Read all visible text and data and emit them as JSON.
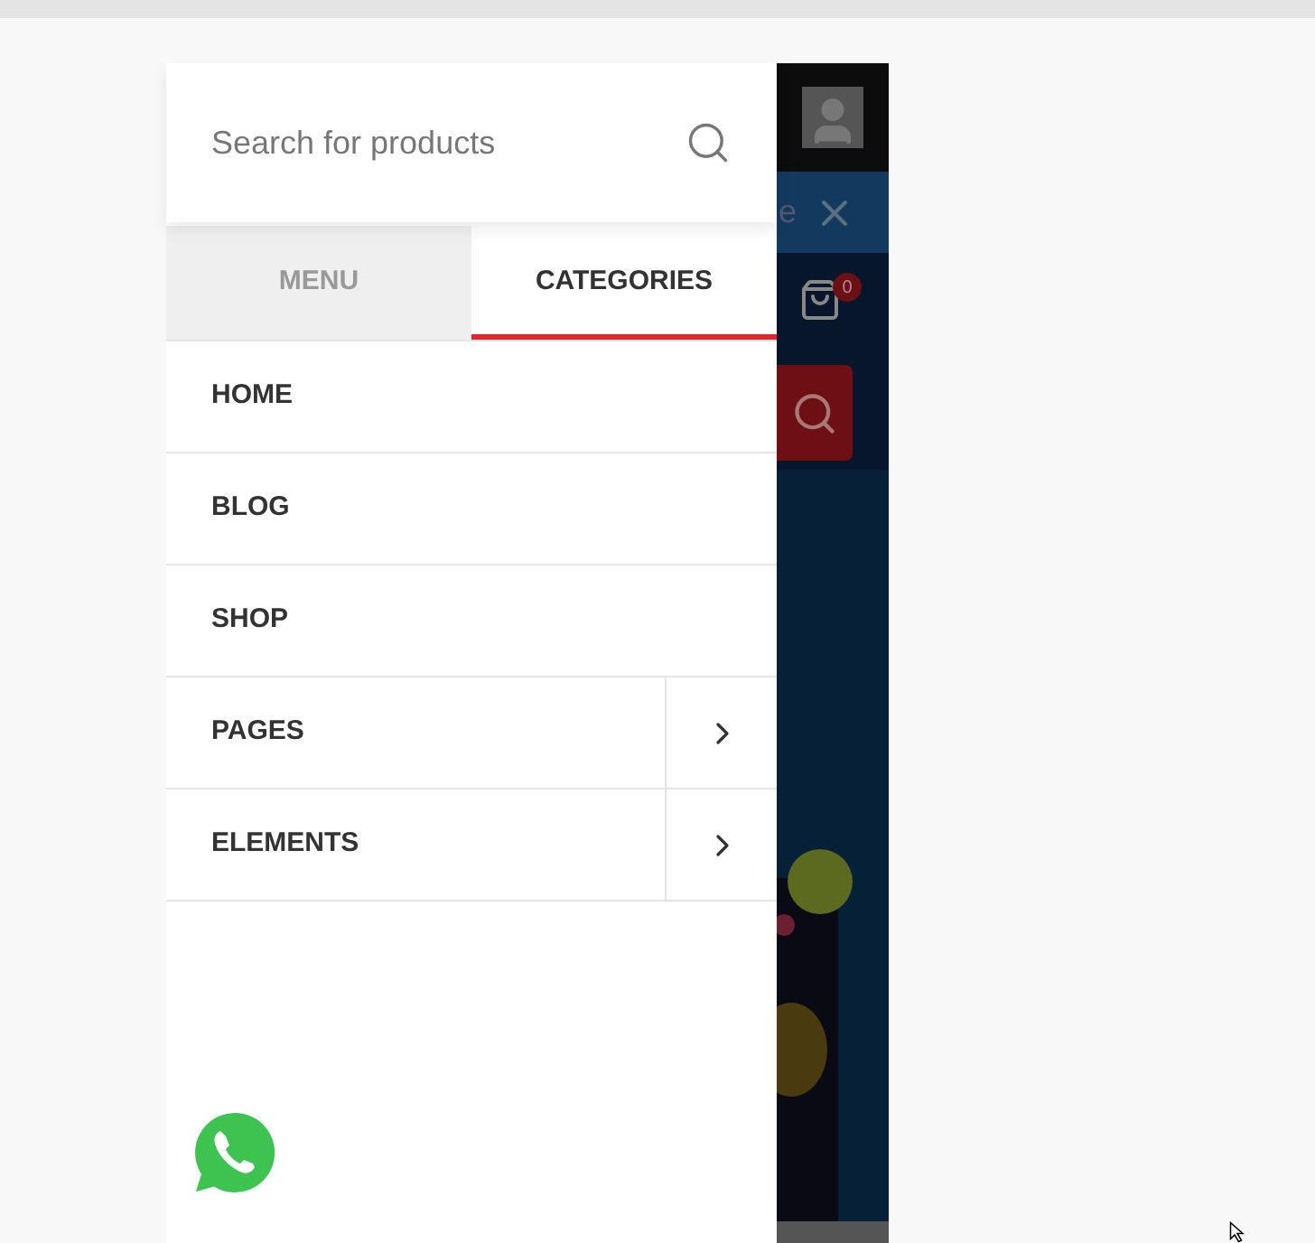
{
  "search": {
    "placeholder": "Search for products"
  },
  "tabs": [
    {
      "label": "MENU",
      "selected": false
    },
    {
      "label": "CATEGORIES",
      "selected": true
    }
  ],
  "menu_items": [
    {
      "label": "HOME",
      "kind": "link"
    },
    {
      "label": "BLOG",
      "kind": "link"
    },
    {
      "label": "SHOP",
      "kind": "link"
    },
    {
      "label": "PAGES",
      "kind": "submenu"
    },
    {
      "label": "ELEMENTS",
      "kind": "submenu"
    }
  ],
  "background_page": {
    "notice_fragment": "e",
    "cart_count": "0"
  }
}
